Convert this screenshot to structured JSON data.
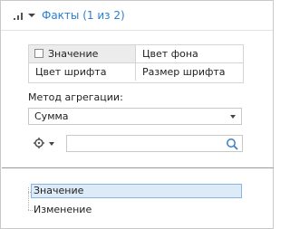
{
  "header": {
    "icon": "signal-bars-icon",
    "title": "Факты (1 из 2)"
  },
  "attributes": {
    "cells": [
      "Значение",
      "Цвет фона",
      "Цвет шрифта",
      "Размер шрифта"
    ]
  },
  "aggregation": {
    "label": "Метод агрегации:",
    "selected": "Сумма"
  },
  "filter": {
    "settings_icon": "gear-icon",
    "search_placeholder": "",
    "search_icon": "search-icon"
  },
  "facts": {
    "items": [
      "Значение",
      "Изменение"
    ],
    "selected_index": 0
  },
  "colors": {
    "title": "#2a7fd4",
    "selected_bg": "#ddebf9",
    "selected_border": "#8ab4e8"
  }
}
